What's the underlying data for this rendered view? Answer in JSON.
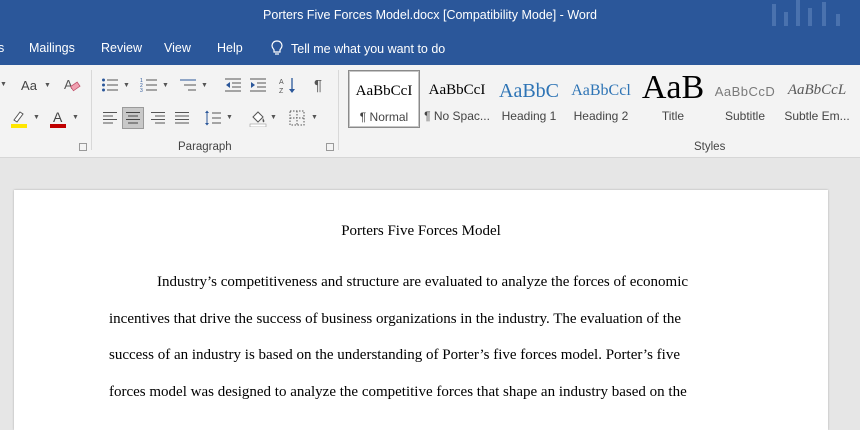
{
  "window": {
    "title": "Porters Five Forces Model.docx [Compatibility Mode]  -  Word"
  },
  "menu": {
    "items": [
      "s",
      "Mailings",
      "Review",
      "View",
      "Help"
    ],
    "tell_me": "Tell me what you want to do"
  },
  "ribbon": {
    "font_group": {
      "change_case": "Aa",
      "font_color": "#c00000",
      "highlight_color": "#ffe600"
    },
    "paragraph_group": {
      "label": "Paragraph",
      "active_alignment": "center"
    },
    "styles_group": {
      "label": "Styles",
      "items": [
        {
          "sample": "AaBbCcI",
          "name": "¶ Normal",
          "selected": true
        },
        {
          "sample": "AaBbCcI",
          "name": "¶ No Spac..."
        },
        {
          "sample": "AaBbC",
          "name": "Heading 1"
        },
        {
          "sample": "AaBbCcl",
          "name": "Heading 2"
        },
        {
          "sample": "AaB",
          "name": "Title"
        },
        {
          "sample": "AaBbCcD",
          "name": "Subtitle"
        },
        {
          "sample": "AaBbCcL",
          "name": "Subtle Em..."
        }
      ]
    }
  },
  "document": {
    "title": "Porters Five Forces Model",
    "lines": [
      "Industry’s competitiveness and structure are evaluated to analyze the forces of economic",
      "incentives that drive the success of business organizations in the industry. The evaluation of the",
      "success of an industry is based on the understanding of Porter’s five forces model. Porter’s five",
      "forces model was designed to analyze the competitive forces that shape an industry based on the"
    ]
  },
  "colors": {
    "word_blue": "#2b579a",
    "ribbon_bg": "#f3f3f3",
    "canvas_bg": "#e6e6e6"
  }
}
